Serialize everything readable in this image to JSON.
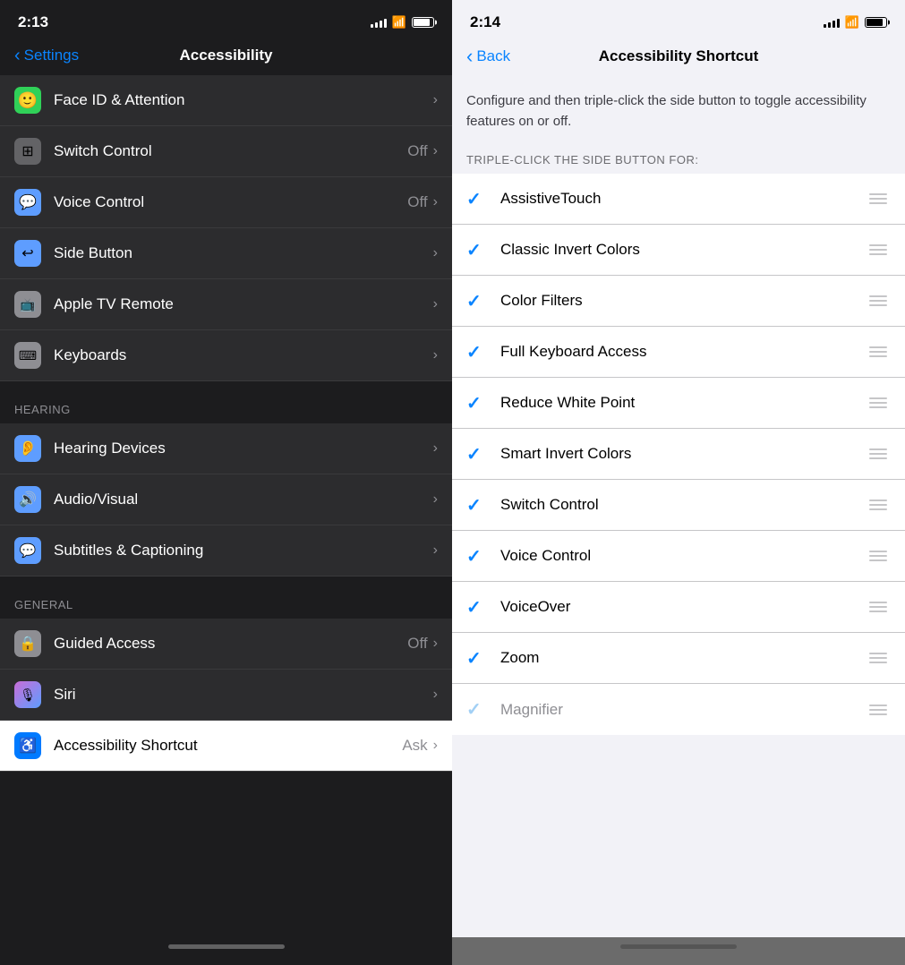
{
  "left": {
    "time": "2:13",
    "nav": {
      "back_label": "Settings",
      "title": "Accessibility"
    },
    "rows": [
      {
        "id": "face-id",
        "icon_bg": "#30d158",
        "icon": "🙂",
        "label": "Face ID & Attention",
        "value": "",
        "show_chevron": true
      },
      {
        "id": "switch-control",
        "icon_bg": "#636366",
        "icon": "⊞",
        "label": "Switch Control",
        "value": "Off",
        "show_chevron": true
      },
      {
        "id": "voice-control",
        "icon_bg": "#5e9dff",
        "icon": "💬",
        "label": "Voice Control",
        "value": "Off",
        "show_chevron": true
      },
      {
        "id": "side-button",
        "icon_bg": "#5e9dff",
        "icon": "↩",
        "label": "Side Button",
        "value": "",
        "show_chevron": true
      },
      {
        "id": "apple-tv-remote",
        "icon_bg": "#8e8e93",
        "icon": "📱",
        "label": "Apple TV Remote",
        "value": "",
        "show_chevron": true
      },
      {
        "id": "keyboards",
        "icon_bg": "#8e8e93",
        "icon": "⌨",
        "label": "Keyboards",
        "value": "",
        "show_chevron": true
      }
    ],
    "hearing_section": "HEARING",
    "hearing_rows": [
      {
        "id": "hearing-devices",
        "icon_bg": "#5e9dff",
        "icon": "👂",
        "label": "Hearing Devices",
        "value": "",
        "show_chevron": true
      },
      {
        "id": "audio-visual",
        "icon_bg": "#5e9dff",
        "icon": "🔊",
        "label": "Audio/Visual",
        "value": "",
        "show_chevron": true
      },
      {
        "id": "subtitles",
        "icon_bg": "#5e9dff",
        "icon": "💬",
        "label": "Subtitles & Captioning",
        "value": "",
        "show_chevron": true
      }
    ],
    "general_section": "GENERAL",
    "general_rows": [
      {
        "id": "guided-access",
        "icon_bg": "#8e8e93",
        "icon": "🔒",
        "label": "Guided Access",
        "value": "Off",
        "show_chevron": true
      },
      {
        "id": "siri",
        "icon_bg": "#c86dd7",
        "icon": "🎙",
        "label": "Siri",
        "value": "",
        "show_chevron": true
      }
    ],
    "accessibility_shortcut": {
      "id": "accessibility-shortcut",
      "icon_bg": "#007aff",
      "icon": "♿",
      "label": "Accessibility Shortcut",
      "value": "Ask",
      "show_chevron": true
    }
  },
  "right": {
    "time": "2:14",
    "nav": {
      "back_label": "Back",
      "title": "Accessibility Shortcut"
    },
    "description": "Configure and then triple-click the side button to toggle accessibility features on or off.",
    "section_label": "TRIPLE-CLICK THE SIDE BUTTON FOR:",
    "items": [
      {
        "id": "assistive-touch",
        "label": "AssistiveTouch",
        "checked": true,
        "dimmed": false
      },
      {
        "id": "classic-invert",
        "label": "Classic Invert Colors",
        "checked": true,
        "dimmed": false
      },
      {
        "id": "color-filters",
        "label": "Color Filters",
        "checked": true,
        "dimmed": false
      },
      {
        "id": "full-keyboard",
        "label": "Full Keyboard Access",
        "checked": true,
        "dimmed": false
      },
      {
        "id": "reduce-white",
        "label": "Reduce White Point",
        "checked": true,
        "dimmed": false
      },
      {
        "id": "smart-invert",
        "label": "Smart Invert Colors",
        "checked": true,
        "dimmed": false
      },
      {
        "id": "switch-control",
        "label": "Switch Control",
        "checked": true,
        "dimmed": false
      },
      {
        "id": "voice-control",
        "label": "Voice Control",
        "checked": true,
        "dimmed": false
      },
      {
        "id": "voiceover",
        "label": "VoiceOver",
        "checked": true,
        "dimmed": false
      },
      {
        "id": "zoom",
        "label": "Zoom",
        "checked": true,
        "dimmed": false
      },
      {
        "id": "magnifier",
        "label": "Magnifier",
        "checked": true,
        "dimmed": true
      }
    ]
  }
}
